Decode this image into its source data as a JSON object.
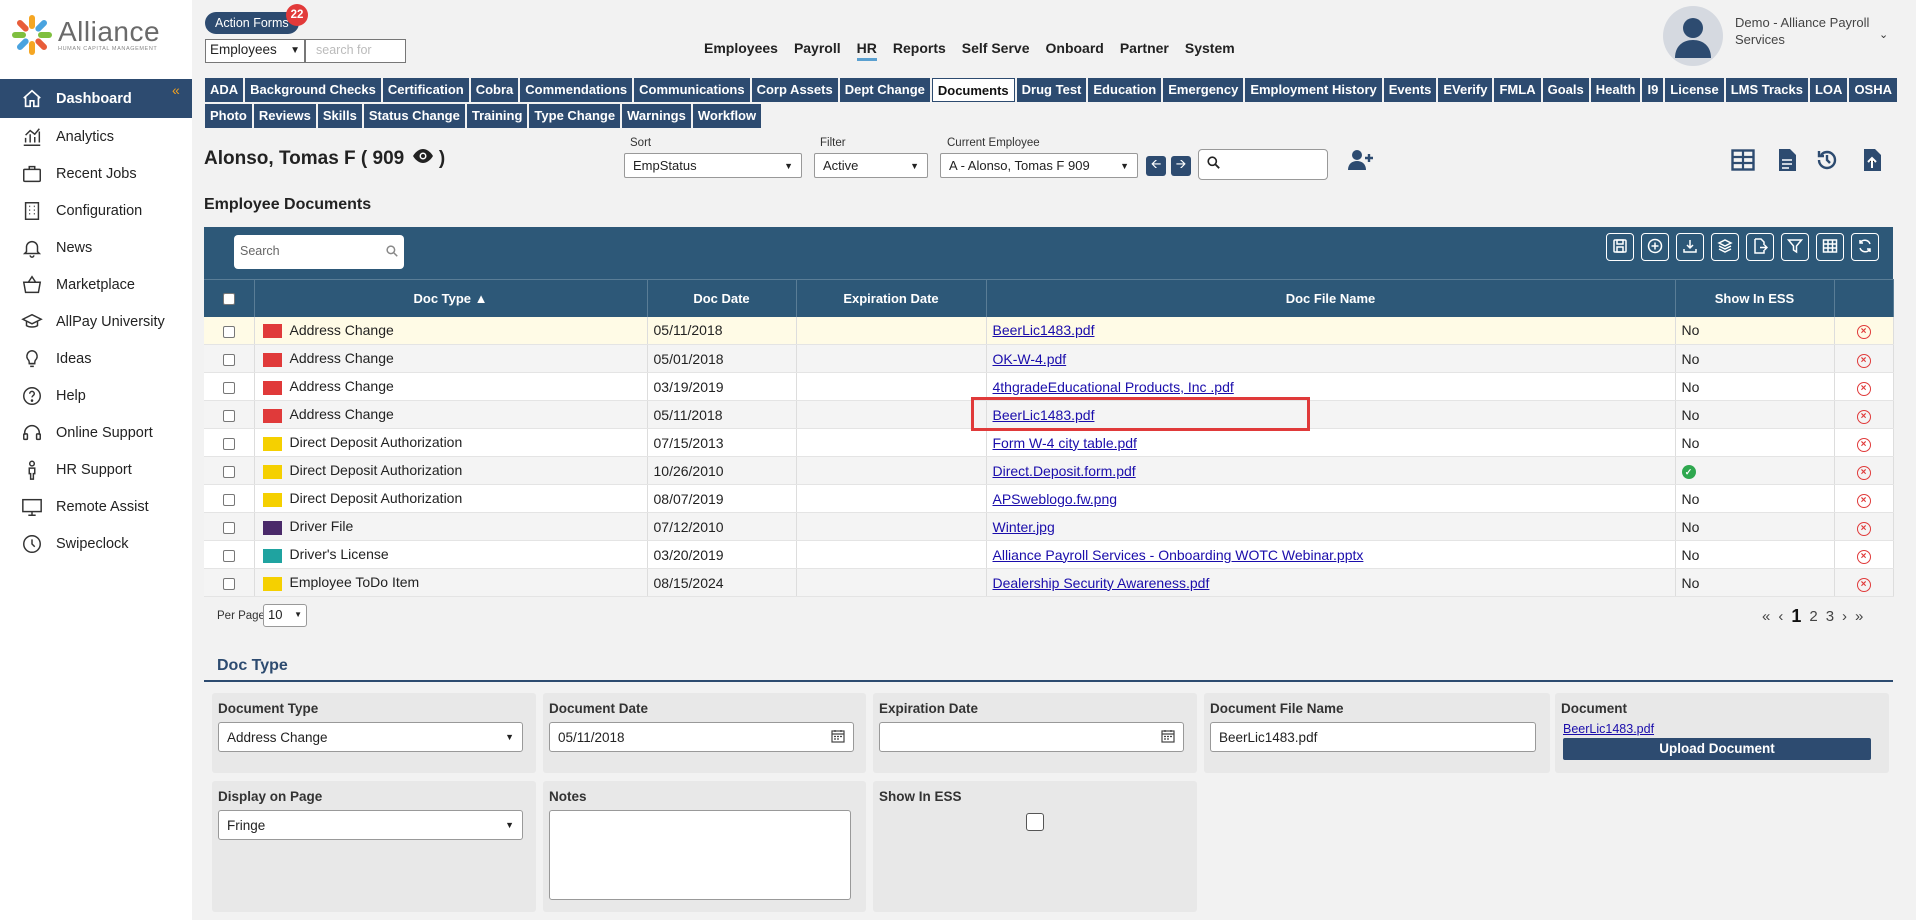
{
  "brand": {
    "name": "Alliance",
    "tagline": "HUMAN CAPITAL MANAGEMENT"
  },
  "sidebar": {
    "items": [
      {
        "label": "Dashboard",
        "icon": "home-icon",
        "active": true
      },
      {
        "label": "Analytics",
        "icon": "analytics-icon"
      },
      {
        "label": "Recent Jobs",
        "icon": "briefcase-icon"
      },
      {
        "label": "Configuration",
        "icon": "building-icon"
      },
      {
        "label": "News",
        "icon": "bell-icon"
      },
      {
        "label": "Marketplace",
        "icon": "basket-icon"
      },
      {
        "label": "AllPay University",
        "icon": "graduation-cap-icon"
      },
      {
        "label": "Ideas",
        "icon": "lightbulb-icon"
      },
      {
        "label": "Help",
        "icon": "question-icon"
      },
      {
        "label": "Online Support",
        "icon": "headset-icon"
      },
      {
        "label": "HR Support",
        "icon": "person-icon"
      },
      {
        "label": "Remote Assist",
        "icon": "monitor-icon"
      },
      {
        "label": "Swipeclock",
        "icon": "clock-icon"
      }
    ]
  },
  "topbar": {
    "action_forms_label": "Action Forms",
    "action_forms_count": "22",
    "scope_select": "Employees",
    "search_placeholder": "search for",
    "nav": [
      "Employees",
      "Payroll",
      "HR",
      "Reports",
      "Self Serve",
      "Onboard",
      "Partner",
      "System"
    ],
    "active_nav": "HR",
    "user_name": "Demo - Alliance Payroll Services"
  },
  "tabs": {
    "row1": [
      "ADA",
      "Background Checks",
      "Certification",
      "Cobra",
      "Commendations",
      "Communications",
      "Corp Assets",
      "Dept Change",
      "Documents",
      "Drug Test",
      "Education",
      "Emergency",
      "Employment History",
      "Events",
      "EVerify",
      "FMLA",
      "Goals",
      "Health",
      "I9",
      "License",
      "LMS Tracks",
      "LOA",
      "OSHA"
    ],
    "row2": [
      "Photo",
      "Reviews",
      "Skills",
      "Status Change",
      "Training",
      "Type Change",
      "Warnings",
      "Workflow"
    ],
    "active": "Documents"
  },
  "employee": {
    "name": "Alonso, Tomas F ( 909",
    "sort_label": "Sort",
    "sort_value": "EmpStatus",
    "filter_label": "Filter",
    "filter_value": "Active",
    "current_label": "Current Employee",
    "current_value": "A - Alonso, Tomas F 909"
  },
  "section_title": "Employee Documents",
  "grid": {
    "search_placeholder": "Search",
    "columns": [
      "Doc Type ▲",
      "Doc Date",
      "Expiration Date",
      "Doc File Name",
      "Show In ESS"
    ],
    "rows": [
      {
        "doc_type": "Address Change",
        "folder_color": "#e03a3a",
        "doc_date": "05/11/2018",
        "exp": "",
        "file": "BeerLic1483.pdf",
        "ess": "No"
      },
      {
        "doc_type": "Address Change",
        "folder_color": "#e03a3a",
        "doc_date": "05/01/2018",
        "exp": "",
        "file": "OK-W-4.pdf",
        "ess": "No"
      },
      {
        "doc_type": "Address Change",
        "folder_color": "#e03a3a",
        "doc_date": "03/19/2019",
        "exp": "",
        "file": "4thgradeEducational Products, Inc .pdf",
        "ess": "No"
      },
      {
        "doc_type": "Address Change",
        "folder_color": "#e03a3a",
        "doc_date": "05/11/2018",
        "exp": "",
        "file": "BeerLic1483.pdf",
        "ess": "No"
      },
      {
        "doc_type": "Direct Deposit Authorization",
        "folder_color": "#f5d000",
        "doc_date": "07/15/2013",
        "exp": "",
        "file": "Form W-4 city table.pdf",
        "ess": "No"
      },
      {
        "doc_type": "Direct Deposit Authorization",
        "folder_color": "#f5d000",
        "doc_date": "10/26/2010",
        "exp": "",
        "file": "Direct.Deposit.form.pdf",
        "ess": "check"
      },
      {
        "doc_type": "Direct Deposit Authorization",
        "folder_color": "#f5d000",
        "doc_date": "08/07/2019",
        "exp": "",
        "file": "APSweblogo.fw.png",
        "ess": "No"
      },
      {
        "doc_type": "Driver File",
        "folder_color": "#4a2a6a",
        "doc_date": "07/12/2010",
        "exp": "",
        "file": "Winter.jpg",
        "ess": "No"
      },
      {
        "doc_type": "Driver's License",
        "folder_color": "#1fa3a0",
        "doc_date": "03/20/2019",
        "exp": "",
        "file": "Alliance Payroll Services - Onboarding WOTC Webinar.pptx",
        "ess": "No"
      },
      {
        "doc_type": "Employee ToDo Item",
        "folder_color": "#f5d000",
        "doc_date": "08/15/2024",
        "exp": "",
        "file": "Dealership Security Awareness.pdf",
        "ess": "No"
      }
    ],
    "per_page_label": "Per Page",
    "per_page": "10",
    "pages": [
      "1",
      "2",
      "3"
    ],
    "current_page": "1"
  },
  "detail": {
    "title": "Doc Type",
    "document_type_label": "Document Type",
    "document_type_value": "Address Change",
    "document_date_label": "Document Date",
    "document_date_value": "05/11/2018",
    "expiration_date_label": "Expiration Date",
    "expiration_date_value": "",
    "file_name_label": "Document File Name",
    "file_name_value": "BeerLic1483.pdf",
    "document_label": "Document",
    "document_link": "BeerLic1483.pdf",
    "upload_label": "Upload Document",
    "display_label": "Display on Page",
    "display_value": "Fringe",
    "notes_label": "Notes",
    "show_ess_label": "Show In ESS"
  },
  "colors": {
    "primary": "#2d4b70",
    "grid_header": "#2d5878",
    "accent": "#f0a020",
    "danger": "#e03a3a",
    "success": "#2fa84f"
  }
}
